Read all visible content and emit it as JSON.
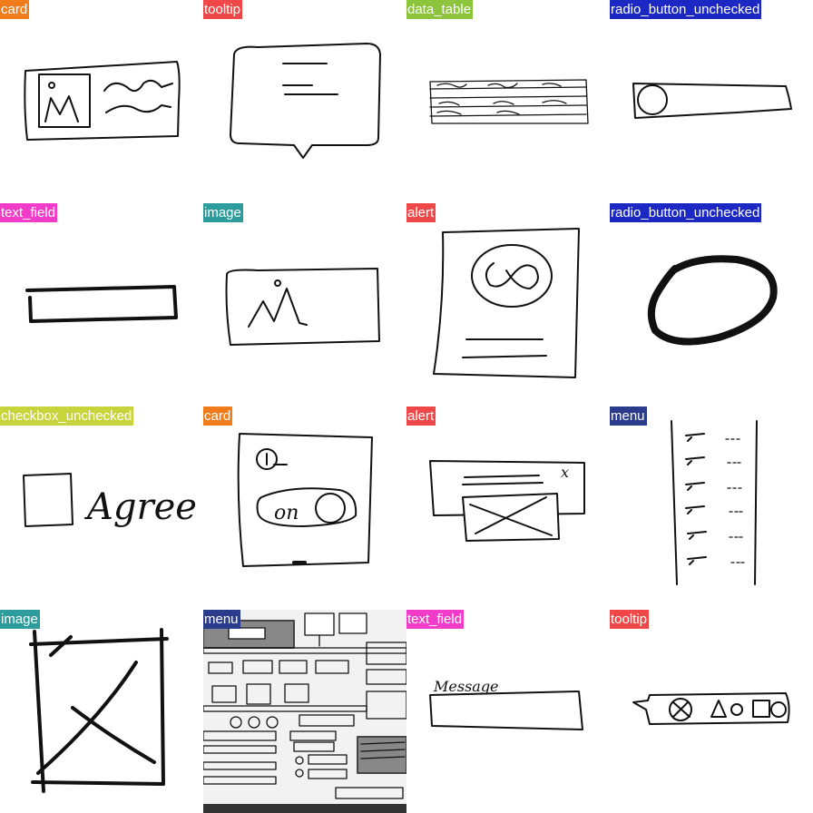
{
  "tiles": [
    {
      "label": "card",
      "color": "#f07c1c"
    },
    {
      "label": "tooltip",
      "color": "#f04848"
    },
    {
      "label": "data_table",
      "color": "#8cc43c"
    },
    {
      "label": "radio_button_unchecked",
      "color": "#1c28c4"
    },
    {
      "label": "text_field",
      "color": "#f03cc8"
    },
    {
      "label": "image",
      "color": "#2c9c9c"
    },
    {
      "label": "alert",
      "color": "#f04848"
    },
    {
      "label": "radio_button_unchecked",
      "color": "#1c28c4"
    },
    {
      "label": "checkbox_unchecked",
      "color": "#c8d43c"
    },
    {
      "label": "card",
      "color": "#f07c1c"
    },
    {
      "label": "alert",
      "color": "#f04848"
    },
    {
      "label": "menu",
      "color": "#2c3c8c"
    },
    {
      "label": "image",
      "color": "#2c9c9c"
    },
    {
      "label": "menu",
      "color": "#2c3c8c"
    },
    {
      "label": "text_field",
      "color": "#f03cc8"
    },
    {
      "label": "tooltip",
      "color": "#f04848"
    }
  ],
  "sketch_text": {
    "agree": "Agree",
    "on": "on",
    "message": "Message",
    "x_mark": "x"
  }
}
